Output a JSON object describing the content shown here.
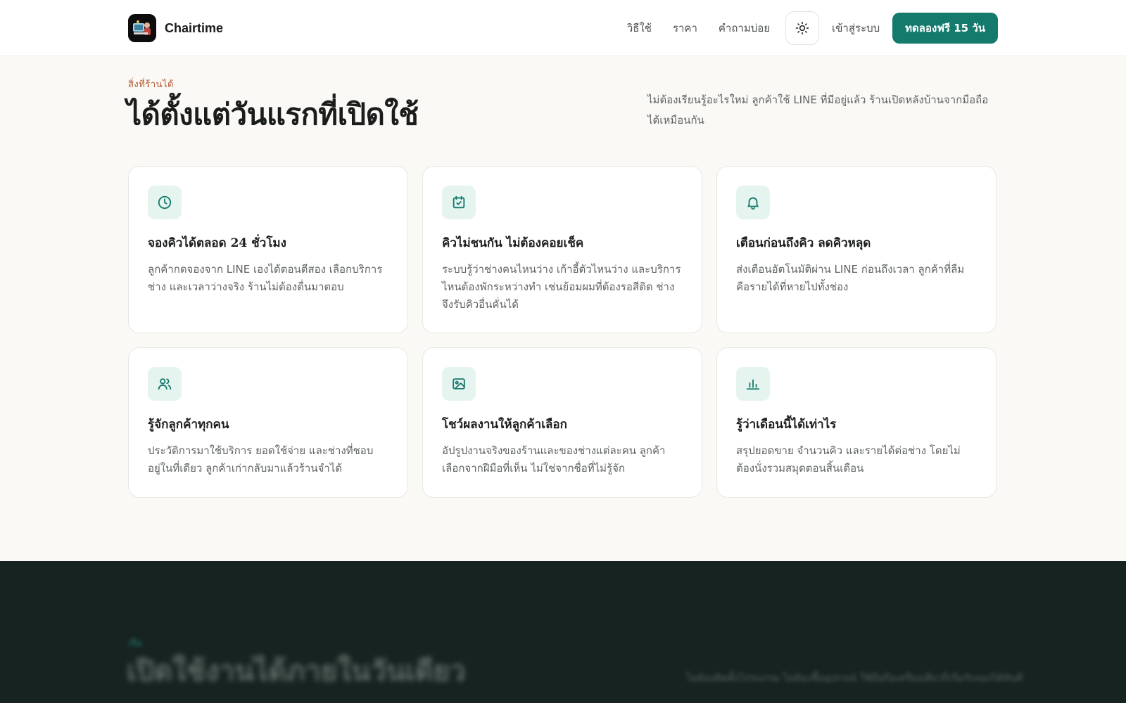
{
  "header": {
    "brand_name": "Chairtime",
    "nav": [
      "วิธีใช้",
      "ราคา",
      "คำถามบ่อย"
    ],
    "login_label": "เข้าสู่ระบบ",
    "cta_label": "ทดลองฟรี 15 วัน"
  },
  "section": {
    "eyebrow": "สิ่งที่ร้านได้",
    "title": "ได้ตั้งแต่วันแรกที่เปิดใช้",
    "subtitle": "ไม่ต้องเรียนรู้อะไรใหม่ ลูกค้าใช้ LINE ที่มีอยู่แล้ว ร้านเปิดหลังบ้านจากมือถือได้เหมือนกัน"
  },
  "features": [
    {
      "icon": "clock-icon",
      "title": "จองคิวได้ตลอด 24 ชั่วโมง",
      "desc": "ลูกค้ากดจองจาก LINE เองได้ตอนตีสอง เลือกบริการ ช่าง และเวลาว่างจริง ร้านไม่ต้องตื่นมาตอบ"
    },
    {
      "icon": "calendar-check-icon",
      "title": "คิวไม่ชนกัน ไม่ต้องคอยเช็ค",
      "desc": "ระบบรู้ว่าช่างคนไหนว่าง เก้าอี้ตัวไหนว่าง และบริการไหนต้องพักระหว่างทำ เช่นย้อมผมที่ต้องรอสีติด ช่างจึงรับคิวอื่นคั่นได้"
    },
    {
      "icon": "bell-icon",
      "title": "เตือนก่อนถึงคิว ลดคิวหลุด",
      "desc": "ส่งเตือนอัตโนมัติผ่าน LINE ก่อนถึงเวลา ลูกค้าที่ลืมคือรายได้ที่หายไปทั้งช่อง"
    },
    {
      "icon": "users-icon",
      "title": "รู้จักลูกค้าทุกคน",
      "desc": "ประวัติการมาใช้บริการ ยอดใช้จ่าย และช่างที่ชอบ อยู่ในที่เดียว ลูกค้าเก่ากลับมาแล้วร้านจำได้"
    },
    {
      "icon": "image-icon",
      "title": "โชว์ผลงานให้ลูกค้าเลือก",
      "desc": "อัปรูปงานจริงของร้านและของช่างแต่ละคน ลูกค้าเลือกจากฝีมือที่เห็น ไม่ใช่จากชื่อที่ไม่รู้จัก"
    },
    {
      "icon": "bar-chart-icon",
      "title": "รู้ว่าเดือนนี้ได้เท่าไร",
      "desc": "สรุปยอดขาย จำนวนคิว และรายได้ต่อช่าง โดยไม่ต้องนั่งรวมสมุดตอนสิ้นเดือน"
    }
  ],
  "next_section": {
    "eyebrow": "เริ่ม",
    "title": "เปิดใช้งานได้ภายในวันเดียว",
    "subtitle": "ไม่ต้องติดตั้งโปรแกรม ไม่ต้องซื้ออุปกรณ์ ใช้มือถือเครื่องเดียวก็เริ่มรับจองได้ทันที"
  },
  "colors": {
    "accent": "#147a6c",
    "eyebrow": "#b5562e",
    "dark_band": "#162320"
  }
}
